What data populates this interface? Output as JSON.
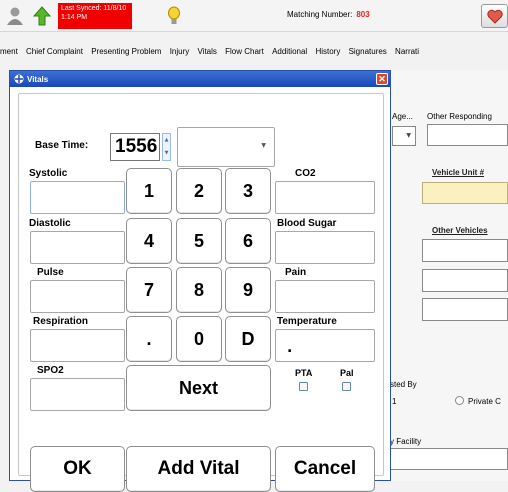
{
  "topbar": {
    "sync_status": "Last Synced: 11/8/10 1:14 PM",
    "matching_label": "Matching Number:",
    "matching_number": "803",
    "icons": [
      "user-icon",
      "up-arrow-icon",
      "lightbulb-icon",
      "heart-icon"
    ]
  },
  "tabs": [
    "ment",
    "Chief Complaint",
    "Presenting Problem",
    "Injury",
    "Vitals",
    "Flow Chart",
    "Additional",
    "History",
    "Signatures",
    "Narrati"
  ],
  "background_form": {
    "age_label": "Age...",
    "other_responding_label": "Other Responding",
    "vehicle_unit_label": "Vehicle Unit #",
    "other_vehicles_label": "Other Vehicles",
    "requested_by_label": "sted By",
    "requested_by_value": "1",
    "private_label": "Private C",
    "facility_label": "y Facility"
  },
  "dialog": {
    "title": "Vitals",
    "base_time_label": "Base Time:",
    "base_time_value": "1556",
    "fields": {
      "systolic": "Systolic",
      "diastolic": "Diastolic",
      "pulse": "Pulse",
      "respiration": "Respiration",
      "spo2": "SPO2",
      "co2": "CO2",
      "blood_sugar": "Blood Sugar",
      "pain": "Pain",
      "temperature": "Temperature",
      "temperature_value": "."
    },
    "checkboxes": {
      "pta": "PTA",
      "pal": "Pal"
    },
    "keypad": {
      "k1": "1",
      "k2": "2",
      "k3": "3",
      "k4": "4",
      "k5": "5",
      "k6": "6",
      "k7": "7",
      "k8": "8",
      "k9": "9",
      "kdot": ".",
      "k0": "0",
      "kD": "D",
      "next": "Next"
    },
    "buttons": {
      "ok": "OK",
      "add_vital": "Add Vital",
      "cancel": "Cancel"
    }
  }
}
